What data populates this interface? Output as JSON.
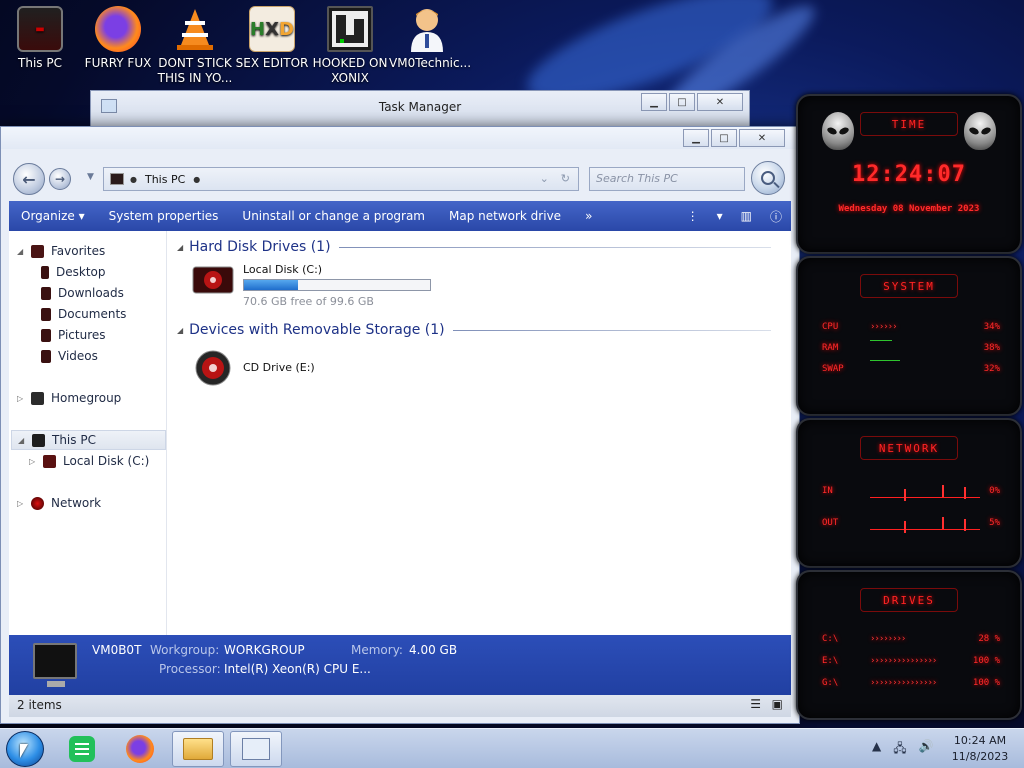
{
  "desktop": {
    "icons": [
      {
        "label": "This PC",
        "icon": "this-pc-icon"
      },
      {
        "label": "FURRY FUX",
        "icon": "firefox-icon"
      },
      {
        "label": "DONT STICK THIS IN YO...",
        "icon": "vlc-cone-icon"
      },
      {
        "label": "SEX EDITOR",
        "icon": "hxd-hex-editor-icon"
      },
      {
        "label": "HOOKED ON XONIX",
        "icon": "xonix-game-icon"
      },
      {
        "label": "VM0Technic...",
        "icon": "doctor-icon"
      }
    ]
  },
  "task_manager": {
    "title": "Task Manager"
  },
  "explorer": {
    "address": {
      "crumb": "This PC"
    },
    "search": {
      "placeholder": "Search This PC"
    },
    "commands": {
      "organize": "Organize",
      "system_properties": "System properties",
      "uninstall": "Uninstall or change a program",
      "map_drive": "Map network drive",
      "more": "»"
    },
    "nav": {
      "favorites": "Favorites",
      "desktop": "Desktop",
      "downloads": "Downloads",
      "documents": "Documents",
      "pictures": "Pictures",
      "videos": "Videos",
      "homegroup": "Homegroup",
      "this_pc": "This PC",
      "local_disk": "Local Disk (C:)",
      "network": "Network"
    },
    "groups": {
      "hdd": "Hard Disk Drives (1)",
      "removable": "Devices with Removable Storage (1)"
    },
    "drives": {
      "c": {
        "name": "Local Disk (C:)",
        "free": "70.6 GB free of 99.6 GB",
        "used_fraction": 0.291
      },
      "e": {
        "name": "CD Drive (E:)"
      }
    },
    "details": {
      "computer_name": "VM0B0T",
      "workgroup_label": "Workgroup:",
      "workgroup_value": "WORKGROUP",
      "memory_label": "Memory:",
      "memory_value": "4.00 GB",
      "processor_label": "Processor:",
      "processor_value": "Intel(R) Xeon(R) CPU E..."
    },
    "status": {
      "items": "2 items"
    }
  },
  "gadgets": {
    "time": {
      "header": "TIME",
      "clock": "12:24:07",
      "date": "Wednesday 08 November 2023"
    },
    "system": {
      "header": "SYSTEM",
      "rows": [
        {
          "name": "CPU",
          "bar": "››››››",
          "value": "34%"
        },
        {
          "name": "RAM",
          "bar": "",
          "value": "38%"
        },
        {
          "name": "SWAP",
          "bar": "",
          "value": "32%"
        }
      ]
    },
    "network": {
      "header": "NETWORK",
      "rows": [
        {
          "name": "IN",
          "value": "0%"
        },
        {
          "name": "OUT",
          "value": "5%"
        }
      ]
    },
    "drives": {
      "header": "DRIVES",
      "rows": [
        {
          "name": "C:\\",
          "bar": "››››››››",
          "value": "28 %"
        },
        {
          "name": "E:\\",
          "bar": "›››››››››››››››",
          "value": "100 %"
        },
        {
          "name": "G:\\",
          "bar": "›››››››››››››››",
          "value": "100 %"
        }
      ]
    }
  },
  "taskbar": {
    "clock_time": "10:24 AM",
    "clock_date": "11/8/2023"
  },
  "colors": {
    "accent_blue": "#2a48a8",
    "gadget_red": "#ff2a2a",
    "drive_fill": "#1f6dcc"
  }
}
